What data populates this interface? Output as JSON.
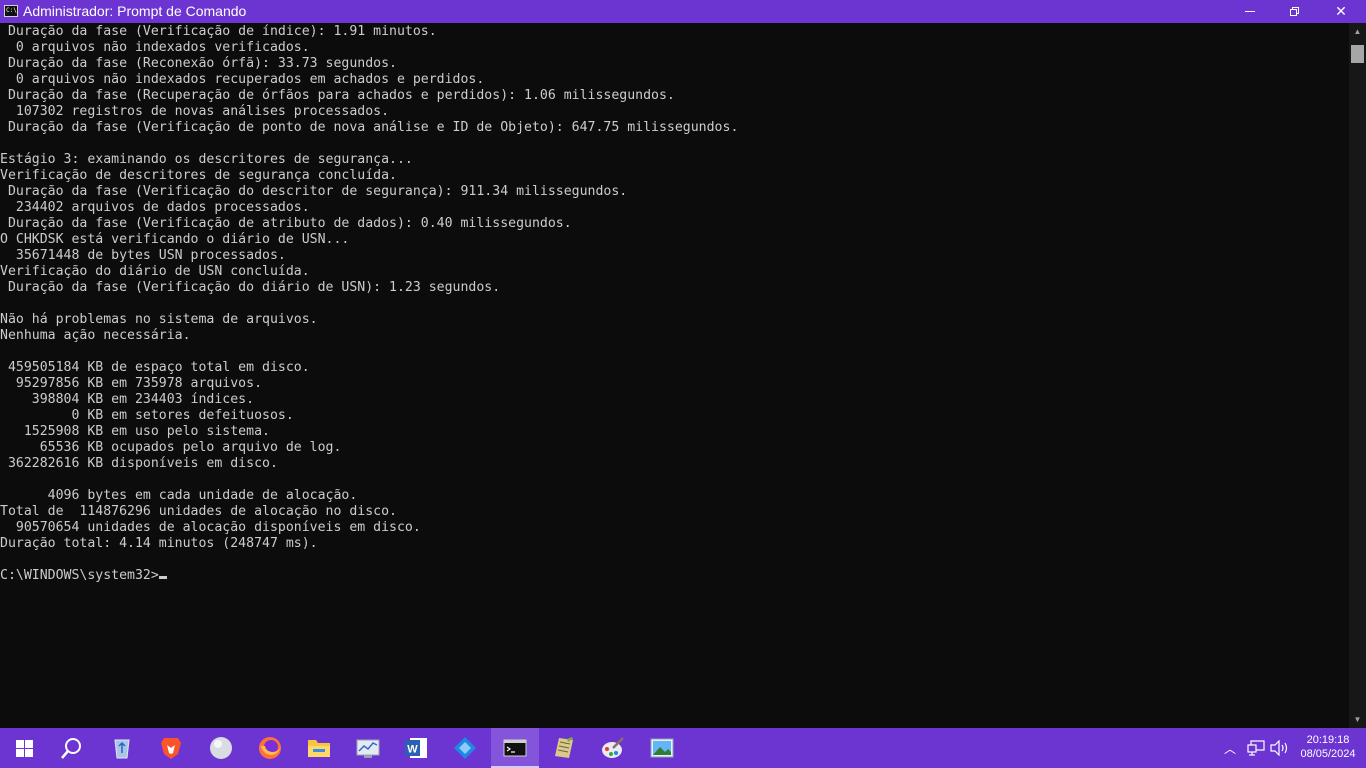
{
  "window": {
    "title": "Administrador: Prompt de Comando",
    "icon_name": "cmd-icon",
    "icon_glyph": "C:\\_"
  },
  "controls": {
    "minimize": "minimize-icon",
    "maximize": "restore-icon",
    "close_glyph": "✕"
  },
  "console": {
    "text": " Duração da fase (Verificação de índice): 1.91 minutos.\n  0 arquivos não indexados verificados.\n Duração da fase (Reconexão órfã): 33.73 segundos.\n  0 arquivos não indexados recuperados em achados e perdidos.\n Duração da fase (Recuperação de órfãos para achados e perdidos): 1.06 milissegundos.\n  107302 registros de novas análises processados.\n Duração da fase (Verificação de ponto de nova análise e ID de Objeto): 647.75 milissegundos.\n\nEstágio 3: examinando os descritores de segurança...\nVerificação de descritores de segurança concluída.\n Duração da fase (Verificação do descritor de segurança): 911.34 milissegundos.\n  234402 arquivos de dados processados.\n Duração da fase (Verificação de atributo de dados): 0.40 milissegundos.\nO CHKDSK está verificando o diário de USN...\n  35671448 de bytes USN processados.\nVerificação do diário de USN concluída.\n Duração da fase (Verificação do diário de USN): 1.23 segundos.\n\nNão há problemas no sistema de arquivos.\nNenhuma ação necessária.\n\n 459505184 KB de espaço total em disco.\n  95297856 KB em 735978 arquivos.\n    398804 KB em 234403 índices.\n         0 KB em setores defeituosos.\n   1525908 KB em uso pelo sistema.\n     65536 KB ocupados pelo arquivo de log.\n 362282616 KB disponíveis em disco.\n\n      4096 bytes em cada unidade de alocação.\nTotal de  114876296 unidades de alocação no disco.\n  90570654 unidades de alocação disponíveis em disco.\nDuração total: 4.14 minutos (248747 ms).\n\n",
    "prompt": "C:\\WINDOWS\\system32>"
  },
  "scrollbar": {
    "up_glyph": "▲",
    "down_glyph": "▼"
  },
  "taskbar": {
    "items": [
      {
        "name": "start-icon"
      },
      {
        "name": "search-icon"
      },
      {
        "name": "recycle-bin-icon"
      },
      {
        "name": "brave-browser-icon"
      },
      {
        "name": "app-sphere-icon"
      },
      {
        "name": "firefox-icon"
      },
      {
        "name": "file-explorer-icon"
      },
      {
        "name": "system-monitor-icon"
      },
      {
        "name": "word-icon"
      },
      {
        "name": "app-cube-icon"
      },
      {
        "name": "command-prompt-icon",
        "active": true
      },
      {
        "name": "notepad-icon"
      },
      {
        "name": "paint-icon"
      },
      {
        "name": "photos-icon"
      }
    ],
    "tray": {
      "chevron_glyph": "︿",
      "network_name": "network-icon",
      "volume_name": "volume-icon"
    },
    "clock": {
      "time": "20:19:18",
      "date": "08/05/2024"
    }
  },
  "colors": {
    "accent": "#6c34d1",
    "console_bg": "#0c0c0c",
    "console_fg": "#cccccc"
  }
}
